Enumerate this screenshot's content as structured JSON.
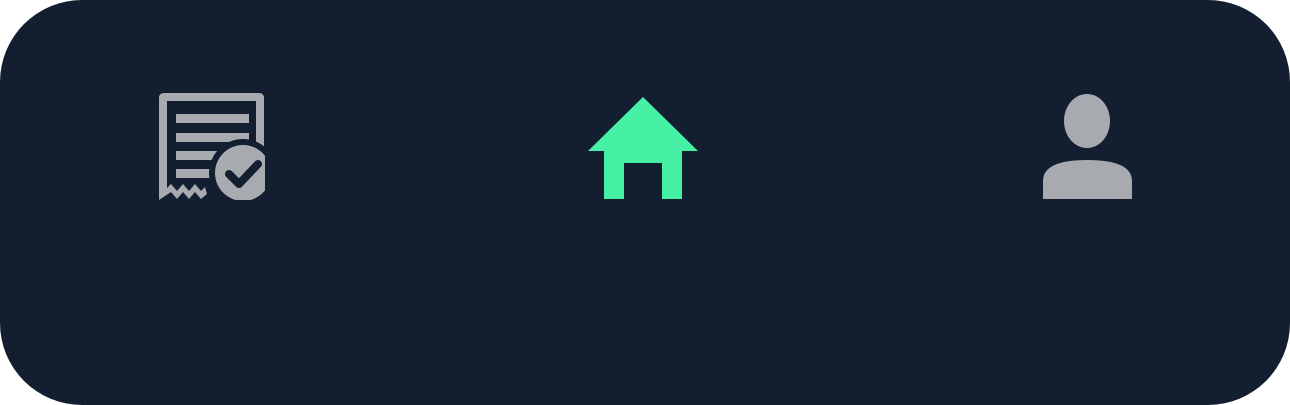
{
  "tab_bar": {
    "active_tab": "home",
    "colors": {
      "background": "#131e31",
      "active": "#46f1a6",
      "inactive": "#a7abb0"
    },
    "tabs": [
      {
        "id": "orders",
        "icon": "receipt-check-icon",
        "active": false
      },
      {
        "id": "home",
        "icon": "home-icon",
        "active": true
      },
      {
        "id": "profile",
        "icon": "person-icon",
        "active": false
      }
    ]
  }
}
